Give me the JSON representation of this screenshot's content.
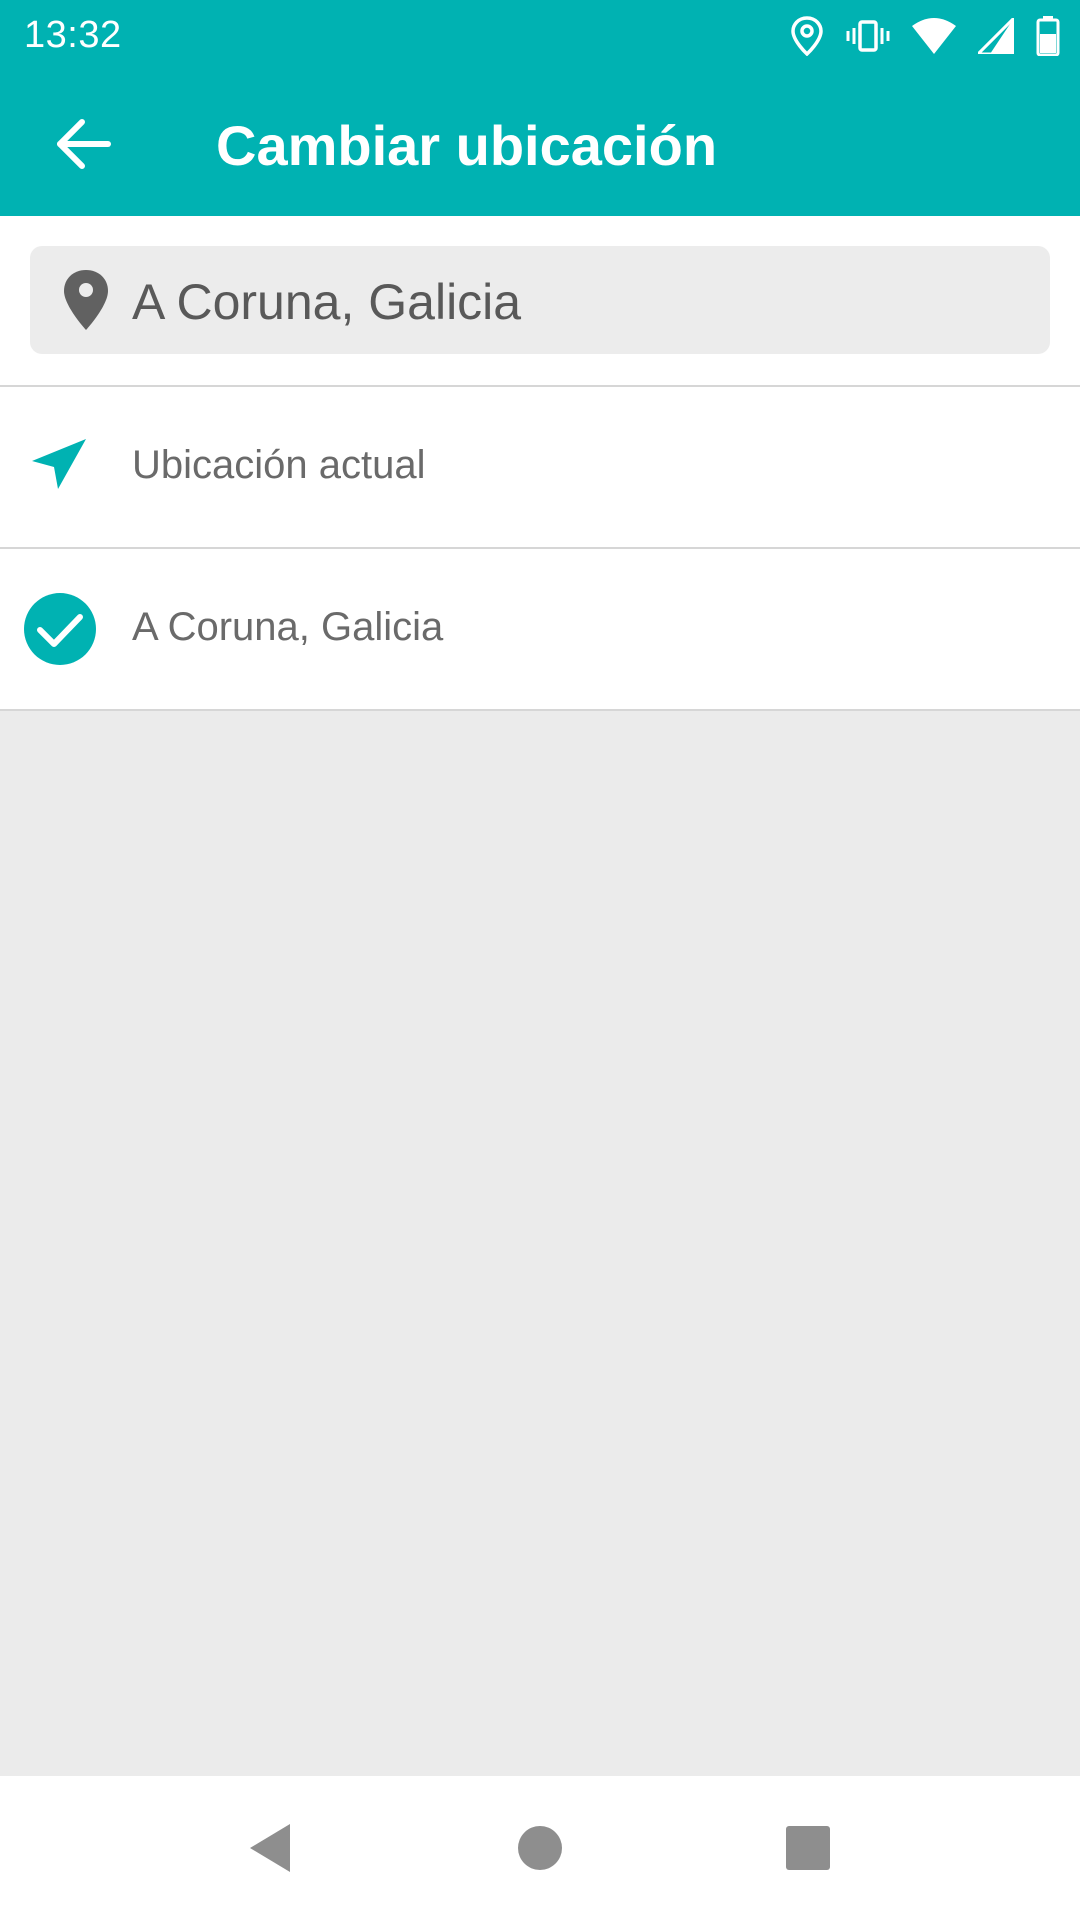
{
  "status_bar": {
    "time": "13:32",
    "icons": [
      "location-icon",
      "vibrate-icon",
      "wifi-icon",
      "signal-icon",
      "battery-icon"
    ]
  },
  "app_bar": {
    "title": "Cambiar ubicación",
    "back_icon": "arrow-back-icon"
  },
  "search": {
    "value": "A Coruna, Galicia",
    "icon": "map-pin-icon"
  },
  "list": {
    "items": [
      {
        "label": "Ubicación actual",
        "icon": "navigation-arrow-icon",
        "selected": false
      },
      {
        "label": "A Coruna, Galicia",
        "icon": "check-circle-icon",
        "selected": true
      }
    ]
  },
  "nav_bar": {
    "buttons": [
      "back-triangle-icon",
      "home-circle-icon",
      "recents-square-icon"
    ]
  },
  "colors": {
    "accent": "#00b2b2",
    "background": "#ebebeb",
    "text_secondary": "#6a6a6a"
  }
}
